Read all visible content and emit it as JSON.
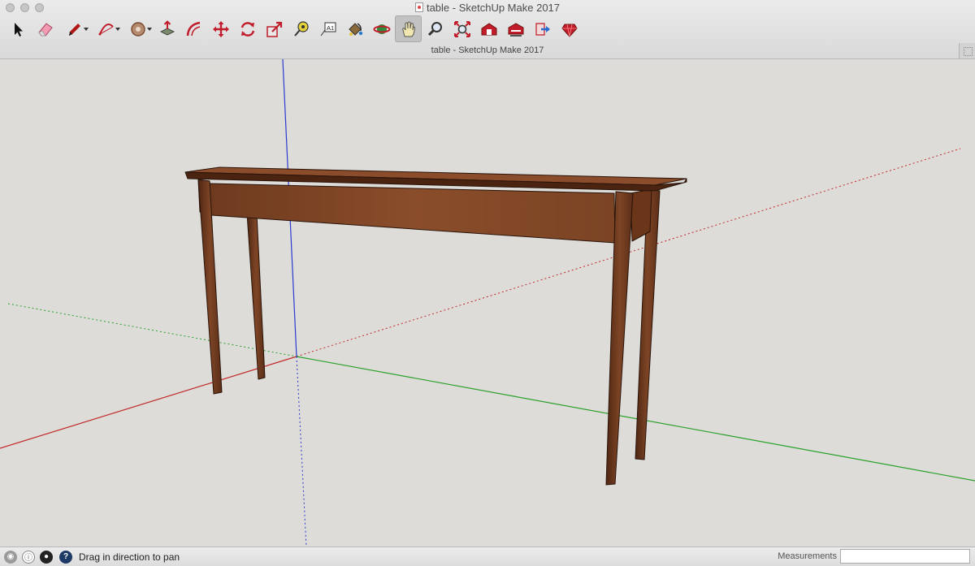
{
  "window": {
    "title": "table - SketchUp Make 2017",
    "doc_tab": "table - SketchUp Make 2017"
  },
  "toolbar": {
    "tools": [
      {
        "name": "select",
        "icon": "arrow-icon"
      },
      {
        "name": "eraser",
        "icon": "eraser-icon"
      },
      {
        "name": "line",
        "icon": "pencil-icon",
        "dropdown": true
      },
      {
        "name": "arc",
        "icon": "arc-icon",
        "dropdown": true
      },
      {
        "name": "shapes",
        "icon": "shapes-icon",
        "dropdown": true
      },
      {
        "name": "push-pull",
        "icon": "push-pull-icon"
      },
      {
        "name": "offset",
        "icon": "offset-icon"
      },
      {
        "name": "move",
        "icon": "move-icon"
      },
      {
        "name": "rotate",
        "icon": "rotate-icon"
      },
      {
        "name": "scale",
        "icon": "scale-icon"
      },
      {
        "name": "tape-measure",
        "icon": "tape-measure-icon"
      },
      {
        "name": "text",
        "icon": "text-icon"
      },
      {
        "name": "paint-bucket",
        "icon": "paint-bucket-icon"
      },
      {
        "name": "orbit",
        "icon": "orbit-icon"
      },
      {
        "name": "pan",
        "icon": "hand-icon",
        "active": true
      },
      {
        "name": "zoom",
        "icon": "magnifier-icon"
      },
      {
        "name": "zoom-extents",
        "icon": "zoom-extents-icon"
      },
      {
        "name": "3d-warehouse",
        "icon": "warehouse-icon"
      },
      {
        "name": "extension-warehouse",
        "icon": "extension-warehouse-icon"
      },
      {
        "name": "share-model",
        "icon": "share-icon"
      },
      {
        "name": "extension-manager",
        "icon": "ruby-icon"
      }
    ]
  },
  "statusbar": {
    "message": "Drag in direction to pan",
    "measurements_label": "Measurements",
    "measurements_value": "",
    "icons": [
      "geo-location-icon",
      "credits-icon",
      "user-icon",
      "help-icon"
    ],
    "help_glyph": "?"
  },
  "colors": {
    "background": "#dddcd8",
    "axis_red": "#c22a2a",
    "axis_green": "#2aa02a",
    "axis_blue": "#2a3ad0",
    "wood": "#7a4122",
    "wood_dark": "#3f1f10"
  }
}
